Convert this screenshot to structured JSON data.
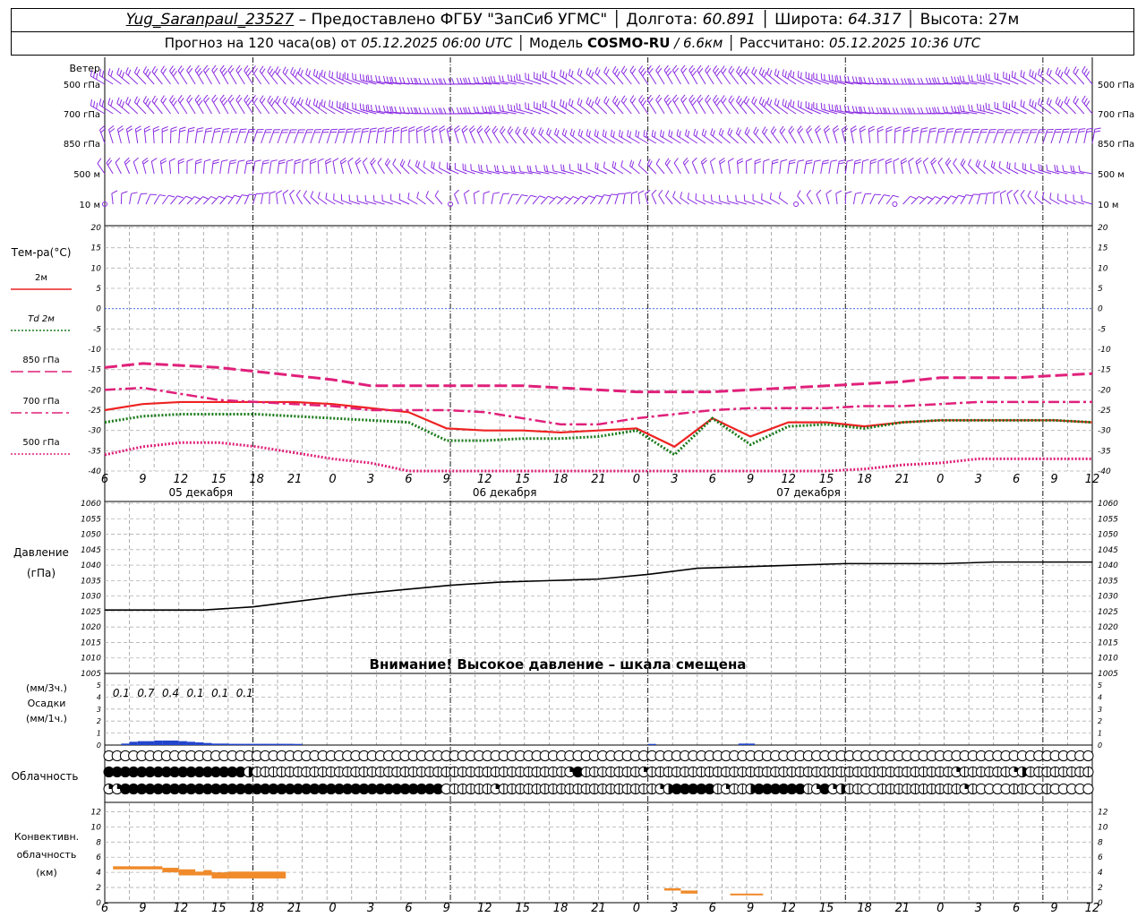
{
  "header": {
    "station": "Yug_Saranpaul_23527",
    "provided_by": "– Предоставлено ФГБУ \"ЗапСиб УГМС\"",
    "lon_label": "Долгота:",
    "lon_value": "60.891",
    "lat_label": "Широта:",
    "lat_value": "64.317",
    "alt_label": "Высота:",
    "alt_value": "27м",
    "forecast_label": "Прогноз на 120 часа(ов) от",
    "forecast_start": "05.12.2025 06:00 UTC",
    "model_label": "Модель",
    "model_name": "COSMO-RU",
    "model_res": "/ 6.6км",
    "calc_label": "Рассчитано:",
    "calc_time": "05.12.2025 10:36 UTC"
  },
  "chart_data": [
    {
      "type": "barbs",
      "panel": "wind",
      "title": "Ветер",
      "levels": [
        "500 гПа",
        "700 гПа",
        "850 гПа",
        "500 м",
        "10 м"
      ],
      "note": "Wind barbs at 5 levels every hour for 120 h"
    },
    {
      "type": "line",
      "panel": "temperature",
      "ylabel": "Тем-ра(°C)",
      "ylim": [
        -40,
        20
      ],
      "yticks": [
        -40,
        -35,
        -30,
        -25,
        -20,
        -15,
        -10,
        -5,
        0,
        5,
        10,
        15,
        20
      ],
      "x_ticks": [
        "6",
        "9",
        "12",
        "15",
        "18",
        "21",
        "0",
        "3",
        "6",
        "9",
        "12",
        "15",
        "18",
        "21",
        "0",
        "3",
        "6",
        "9",
        "12",
        "15",
        "18",
        "21",
        "0",
        "3",
        "6",
        "9",
        "12"
      ],
      "day_labels": [
        "05 декабря",
        "06 декабря",
        "07 декабря"
      ],
      "x_hours": [
        0,
        3,
        6,
        9,
        12,
        15,
        18,
        21,
        24,
        27,
        30,
        33,
        36,
        39,
        42,
        45,
        48,
        51,
        54,
        57,
        60,
        63,
        66,
        69,
        72,
        75,
        78
      ],
      "series": [
        {
          "name": "2м",
          "color": "#ee2222",
          "style": "solid",
          "values": [
            -25,
            -23.5,
            -23,
            -23,
            -23,
            -23,
            -23.5,
            -24.5,
            -25.5,
            -29.5,
            -30,
            -30,
            -30.5,
            -30,
            -29.5,
            -34,
            -27,
            -31.5,
            -28,
            -28,
            -29,
            -28,
            -27.5,
            -27.5,
            -27.5,
            -27.5,
            -28
          ]
        },
        {
          "name": "Td 2м",
          "color": "#1a7a1a",
          "style": "dotted",
          "values": [
            -28,
            -26.5,
            -26,
            -26,
            -26,
            -26.5,
            -27,
            -27.5,
            -28,
            -32.5,
            -32.5,
            -32,
            -32,
            -31.5,
            -30,
            -36,
            -27,
            -33.5,
            -29,
            -28.5,
            -29.5,
            -28,
            -27.5,
            -27.5,
            -27.5,
            -27.5,
            -28
          ]
        },
        {
          "name": "850 гПа",
          "color": "#e0207a",
          "style": "dashed",
          "values": [
            -14.5,
            -13.5,
            -14,
            -14.5,
            -15.5,
            -16.5,
            -17.5,
            -19,
            -19,
            -19,
            -19,
            -19,
            -19.5,
            -20,
            -20.5,
            -20.5,
            -20.5,
            -20,
            -19.5,
            -19,
            -18.5,
            -18,
            -17,
            -17,
            -17,
            -16.5,
            -16
          ]
        },
        {
          "name": "700 гПа",
          "color": "#e0207a",
          "style": "dashdot",
          "values": [
            -20,
            -19.5,
            -21,
            -22.5,
            -23,
            -23.5,
            -24,
            -25,
            -25,
            -25,
            -25.5,
            -27,
            -28.5,
            -28.5,
            -27,
            -26,
            -25,
            -24.5,
            -24.5,
            -24.5,
            -24,
            -24,
            -23.5,
            -23,
            -23,
            -23,
            -23
          ]
        },
        {
          "name": "500 гПа",
          "color": "#e0207a",
          "style": "dotted",
          "values": [
            -36,
            -34,
            -33,
            -33,
            -34,
            -35.5,
            -37,
            -38,
            -40,
            -41,
            -41,
            -41,
            -41,
            -41,
            -41,
            -41,
            -41,
            -41,
            -41,
            -40.5,
            -39.5,
            -38.5,
            -38,
            -37,
            -37,
            -37,
            -37
          ]
        }
      ]
    },
    {
      "type": "line",
      "panel": "pressure",
      "ylabel": "Давление",
      "unit": "(гПа)",
      "ylim": [
        1005,
        1060
      ],
      "yticks": [
        1005,
        1010,
        1015,
        1020,
        1025,
        1030,
        1035,
        1040,
        1045,
        1050,
        1055,
        1060
      ],
      "x_hours": [
        0,
        6,
        12,
        18,
        24,
        30,
        36,
        42,
        48,
        54,
        60,
        66,
        72,
        78,
        84,
        90,
        96,
        102,
        108,
        114,
        120
      ],
      "values": [
        1025.5,
        1025.5,
        1025.5,
        1026.5,
        1028.5,
        1030.5,
        1032,
        1033.5,
        1034.5,
        1035,
        1035.5,
        1037,
        1039,
        1039.5,
        1040,
        1040.5,
        1040.5,
        1040.5,
        1041,
        1041,
        1041
      ],
      "note": "Внимание! Высокое давление – шкала смещена"
    },
    {
      "type": "bar",
      "panel": "precipitation",
      "ylabel_1": "(мм/3ч.)",
      "ylabel_2": "Осадки",
      "ylabel_3": "(мм/1ч.)",
      "ylim": [
        0,
        5
      ],
      "yticks": [
        0,
        1,
        2,
        3,
        4,
        5
      ],
      "sums_3h": [
        "0.1",
        "0.7",
        "0.4",
        "0.1",
        "0.1",
        "0.1"
      ],
      "x_hours": [
        1,
        2,
        3,
        4,
        5,
        6,
        7,
        8,
        9,
        10,
        11,
        12,
        13,
        14,
        15,
        16,
        17,
        18,
        19,
        20,
        21,
        22,
        23,
        24,
        25,
        26,
        27,
        28,
        29,
        30,
        31,
        32,
        33,
        34,
        35,
        36,
        37,
        38,
        39,
        40,
        41,
        42,
        43,
        44,
        45,
        46,
        47,
        48,
        49,
        50,
        51,
        52,
        53,
        54,
        55,
        56,
        57,
        58,
        59,
        60,
        61,
        62,
        63,
        64,
        65,
        66,
        67,
        68,
        69,
        70,
        71,
        72,
        73,
        74,
        75,
        76,
        77,
        78,
        79,
        80,
        81,
        82,
        83,
        84,
        85,
        86,
        87,
        88,
        89,
        90,
        91,
        92,
        93,
        94,
        95,
        96,
        97,
        98,
        99,
        100,
        101,
        102,
        103,
        104,
        105,
        106,
        107,
        108,
        109,
        110,
        111,
        112,
        113,
        114,
        115,
        116,
        117,
        118,
        119,
        120
      ],
      "values": [
        0,
        0,
        0.05,
        0.2,
        0.25,
        0.25,
        0.3,
        0.3,
        0.3,
        0.25,
        0.2,
        0.15,
        0.1,
        0.05,
        0.05,
        0.03,
        0.03,
        0.03,
        0.03,
        0.03,
        0.03,
        0.03,
        0.03,
        0.02,
        0,
        0,
        0,
        0,
        0,
        0,
        0,
        0,
        0,
        0,
        0,
        0,
        0,
        0,
        0,
        0,
        0,
        0,
        0,
        0,
        0,
        0,
        0,
        0,
        0,
        0,
        0,
        0,
        0,
        0,
        0,
        0,
        0,
        0,
        0,
        0,
        0,
        0,
        0,
        0,
        0,
        0,
        0.02,
        0,
        0,
        0,
        0,
        0,
        0,
        0,
        0,
        0,
        0,
        0.05,
        0.05,
        0,
        0,
        0,
        0,
        0,
        0,
        0,
        0,
        0,
        0,
        0,
        0,
        0,
        0,
        0,
        0,
        0,
        0,
        0,
        0,
        0,
        0,
        0,
        0,
        0,
        0,
        0,
        0,
        0,
        0,
        0,
        0,
        0,
        0,
        0,
        0,
        0,
        0,
        0,
        0,
        0
      ]
    },
    {
      "type": "symbols",
      "panel": "cloudiness",
      "ylabel": "Облачность",
      "rows": [
        "000000000000000000000000000000000000000000000000000000000000000000000000000000000000000000000000000000000000000000000000",
        "444444444444444443111111111111111111111111111111111111112411111112111111111111111111111111111111111111121111112311111111",
        "224444444444444444444444444444444444444440111112111111111111111111123444441211344444412423110011111111112100001100100000"
      ]
    },
    {
      "type": "bar",
      "panel": "convective",
      "ylabel_1": "Конвективн.",
      "ylabel_2": "облачность",
      "ylabel_3": "(км)",
      "ylim": [
        0,
        13
      ],
      "yticks": [
        0,
        2,
        4,
        6,
        8,
        10,
        12
      ],
      "color": "#f08a2a",
      "segments": [
        {
          "from": 1,
          "to": 7,
          "base": 4.4,
          "top": 4.8
        },
        {
          "from": 7,
          "to": 9,
          "base": 4.0,
          "top": 4.6
        },
        {
          "from": 9,
          "to": 11,
          "base": 3.6,
          "top": 4.4
        },
        {
          "from": 11,
          "to": 12,
          "base": 3.6,
          "top": 4.1
        },
        {
          "from": 12,
          "to": 13,
          "base": 3.6,
          "top": 4.3
        },
        {
          "from": 13,
          "to": 15,
          "base": 3.2,
          "top": 4.0
        },
        {
          "from": 15,
          "to": 22,
          "base": 3.2,
          "top": 4.1
        },
        {
          "from": 68,
          "to": 70,
          "base": 1.6,
          "top": 1.9
        },
        {
          "from": 70,
          "to": 72,
          "base": 1.2,
          "top": 1.6
        },
        {
          "from": 76,
          "to": 80,
          "base": 1.0,
          "top": 1.2
        }
      ]
    }
  ]
}
